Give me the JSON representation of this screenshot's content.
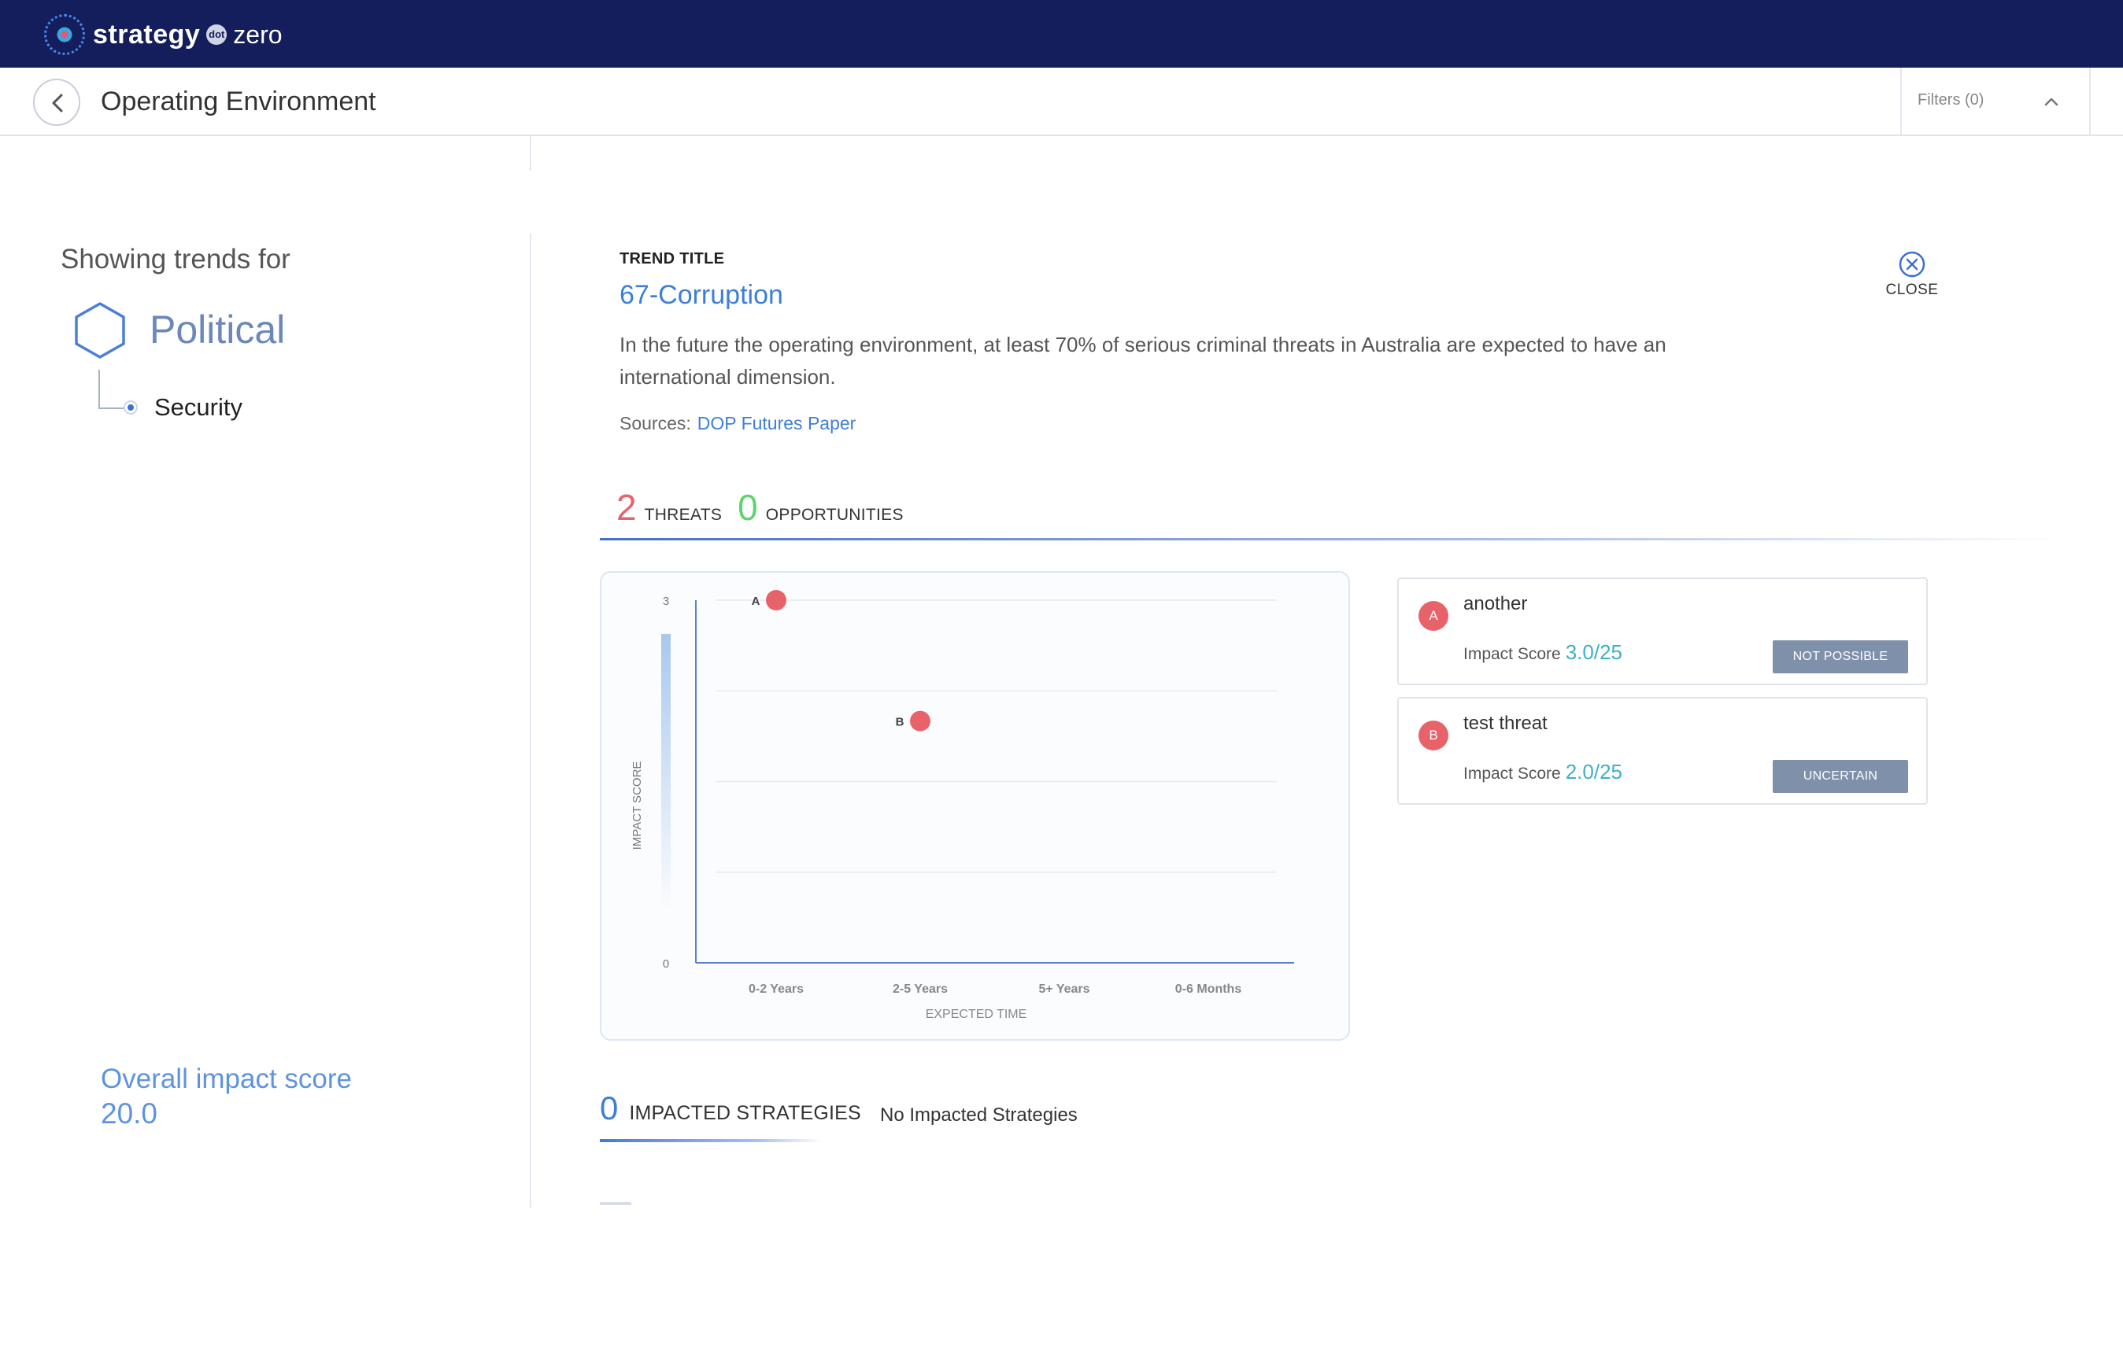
{
  "app": {
    "logo_word": "strategy",
    "logo_mid": "dot",
    "logo_zero": "zero",
    "brand_color": "#141e5c"
  },
  "header": {
    "title": "Operating Environment",
    "filters_label": "Filters (0)"
  },
  "left_panel": {
    "showing_label": "Showing trends for",
    "category": "Political",
    "sub_item": "Security",
    "overall_label": "Overall impact score",
    "overall_value": "20.0"
  },
  "trend": {
    "kicker": "TREND TITLE",
    "title": "67-Corruption",
    "description": "In the future the operating environment, at least 70% of serious criminal threats in Australia are expected to have an international dimension.",
    "sources_label": "Sources:",
    "sources_link": "DOP Futures Paper",
    "close_label": "CLOSE"
  },
  "counts": {
    "threats_value": "2",
    "threats_label": "THREATS",
    "opportunities_value": "0",
    "opportunities_label": "OPPORTUNITIES"
  },
  "chart_data": {
    "type": "scatter",
    "xlabel": "EXPECTED TIME",
    "ylabel": "IMPACT SCORE",
    "categories": [
      "0-2 Years",
      "2-5 Years",
      "5+ Years",
      "0-6 Months"
    ],
    "y_ticks": [
      "3",
      "0"
    ],
    "ylim": [
      0,
      3
    ],
    "grid": true,
    "points": [
      {
        "label": "A",
        "category": "0-2 Years",
        "y": 3
      },
      {
        "label": "B",
        "category": "2-5 Years",
        "y": 2
      }
    ],
    "point_color": "#e8626a"
  },
  "threats": [
    {
      "badge": "A",
      "name": "another",
      "score_label": "Impact Score",
      "score": "3.0/25",
      "status": "NOT POSSIBLE"
    },
    {
      "badge": "B",
      "name": "test threat",
      "score_label": "Impact Score",
      "score": "2.0/25",
      "status": "UNCERTAIN"
    }
  ],
  "impacted": {
    "value": "0",
    "label": "IMPACTED STRATEGIES",
    "empty_text": "No Impacted Strategies"
  }
}
